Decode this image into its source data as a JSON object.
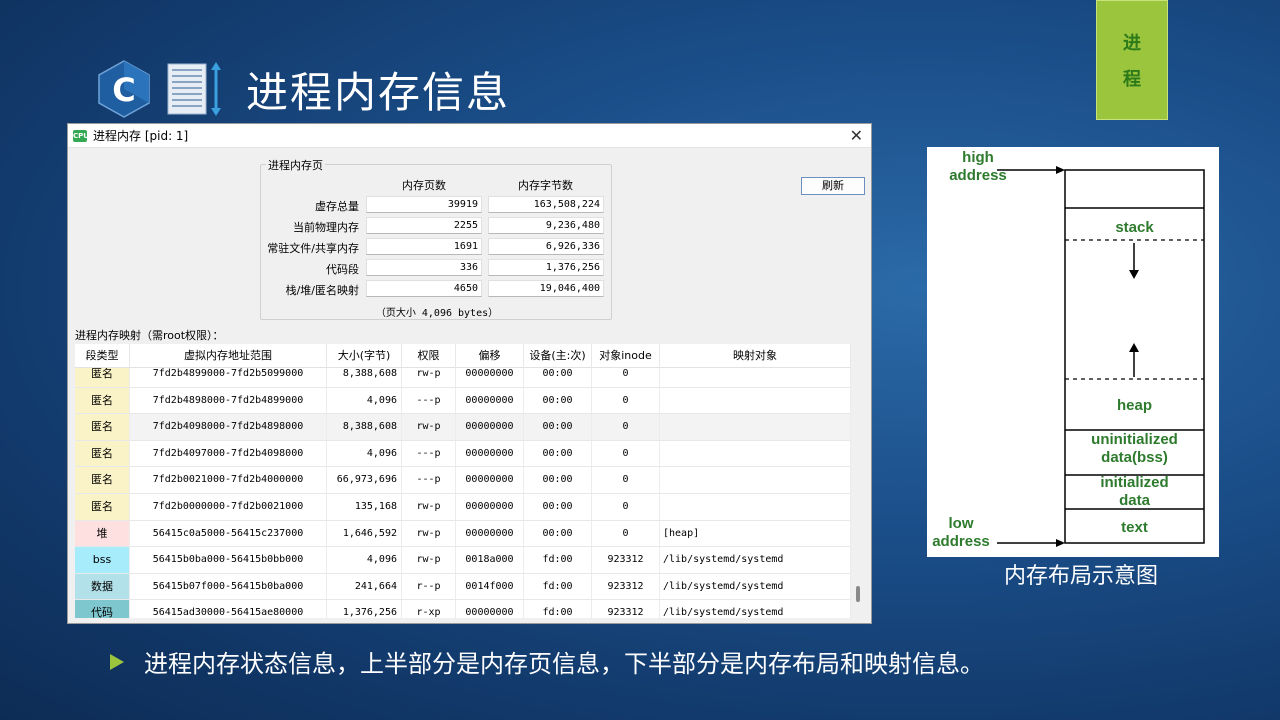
{
  "tag": {
    "chars": [
      "进",
      "程"
    ]
  },
  "slide": {
    "title": "进程内存信息"
  },
  "window": {
    "title": "进程内存 [pid: 1]",
    "icon_text": "CPU",
    "close": "✕",
    "refresh_label": "刷新",
    "pages": {
      "group_label": "进程内存页",
      "col_pages": "内存页数",
      "col_bytes": "内存字节数",
      "rows": [
        {
          "label": "虚存总量",
          "pages": "39919",
          "bytes": "163,508,224"
        },
        {
          "label": "当前物理内存",
          "pages": "2255",
          "bytes": "9,236,480"
        },
        {
          "label": "常驻文件/共享内存",
          "pages": "1691",
          "bytes": "6,926,336"
        },
        {
          "label": "代码段",
          "pages": "336",
          "bytes": "1,376,256"
        },
        {
          "label": "栈/堆/匿名映射",
          "pages": "4650",
          "bytes": "19,046,400"
        }
      ],
      "footer": "（页大小 4,096 bytes）"
    },
    "map_label": "进程内存映射（需root权限）：",
    "table": {
      "headers": [
        "段类型",
        "虚拟内存地址范围",
        "大小(字节)",
        "权限",
        "偏移",
        "设备(主:次)",
        "对象inode",
        "映射对象"
      ],
      "rows": [
        {
          "type": "匿名",
          "range": "7fd2b4899000-7fd2b5099000",
          "size": "8,388,608",
          "perm": "rw-p",
          "offset": "00000000",
          "dev": "00:00",
          "inode": "0",
          "obj": ""
        },
        {
          "type": "匿名",
          "range": "7fd2b4898000-7fd2b4899000",
          "size": "4,096",
          "perm": "---p",
          "offset": "00000000",
          "dev": "00:00",
          "inode": "0",
          "obj": ""
        },
        {
          "type": "匿名",
          "range": "7fd2b4098000-7fd2b4898000",
          "size": "8,388,608",
          "perm": "rw-p",
          "offset": "00000000",
          "dev": "00:00",
          "inode": "0",
          "obj": ""
        },
        {
          "type": "匿名",
          "range": "7fd2b4097000-7fd2b4098000",
          "size": "4,096",
          "perm": "---p",
          "offset": "00000000",
          "dev": "00:00",
          "inode": "0",
          "obj": ""
        },
        {
          "type": "匿名",
          "range": "7fd2b0021000-7fd2b4000000",
          "size": "66,973,696",
          "perm": "---p",
          "offset": "00000000",
          "dev": "00:00",
          "inode": "0",
          "obj": ""
        },
        {
          "type": "匿名",
          "range": "7fd2b0000000-7fd2b0021000",
          "size": "135,168",
          "perm": "rw-p",
          "offset": "00000000",
          "dev": "00:00",
          "inode": "0",
          "obj": ""
        },
        {
          "type": "堆",
          "range": "56415c0a5000-56415c237000",
          "size": "1,646,592",
          "perm": "rw-p",
          "offset": "00000000",
          "dev": "00:00",
          "inode": "0",
          "obj": "[heap]"
        },
        {
          "type": "bss",
          "range": "56415b0ba000-56415b0bb000",
          "size": "4,096",
          "perm": "rw-p",
          "offset": "0018a000",
          "dev": "fd:00",
          "inode": "923312",
          "obj": "/lib/systemd/systemd"
        },
        {
          "type": "数据",
          "range": "56415b07f000-56415b0ba000",
          "size": "241,664",
          "perm": "r--p",
          "offset": "0014f000",
          "dev": "fd:00",
          "inode": "923312",
          "obj": "/lib/systemd/systemd"
        },
        {
          "type": "代码",
          "range": "56415ad30000-56415ae80000",
          "size": "1,376,256",
          "perm": "r-xp",
          "offset": "00000000",
          "dev": "fd:00",
          "inode": "923312",
          "obj": "/lib/systemd/systemd"
        }
      ]
    }
  },
  "diagram": {
    "high_address": "high\naddress",
    "low_address": "low\naddress",
    "stack": "stack",
    "heap": "heap",
    "bss": "uninitialized\ndata(bss)",
    "data": "initialized\ndata",
    "text": "text",
    "label_color": "#2e7b2e",
    "caption": "内存布局示意图"
  },
  "bullet": {
    "text": "进程内存状态信息，上半部分是内存页信息，下半部分是内存布局和映射信息。"
  },
  "colors": {
    "tag": "#9bc53d",
    "bullet": "#9bc53d",
    "type_anon": "#fbf3c8",
    "type_heap": "#fde0df",
    "type_bss": "#a6ecfb",
    "type_data": "#b2e1ea",
    "type_code": "#7fc7cf"
  }
}
